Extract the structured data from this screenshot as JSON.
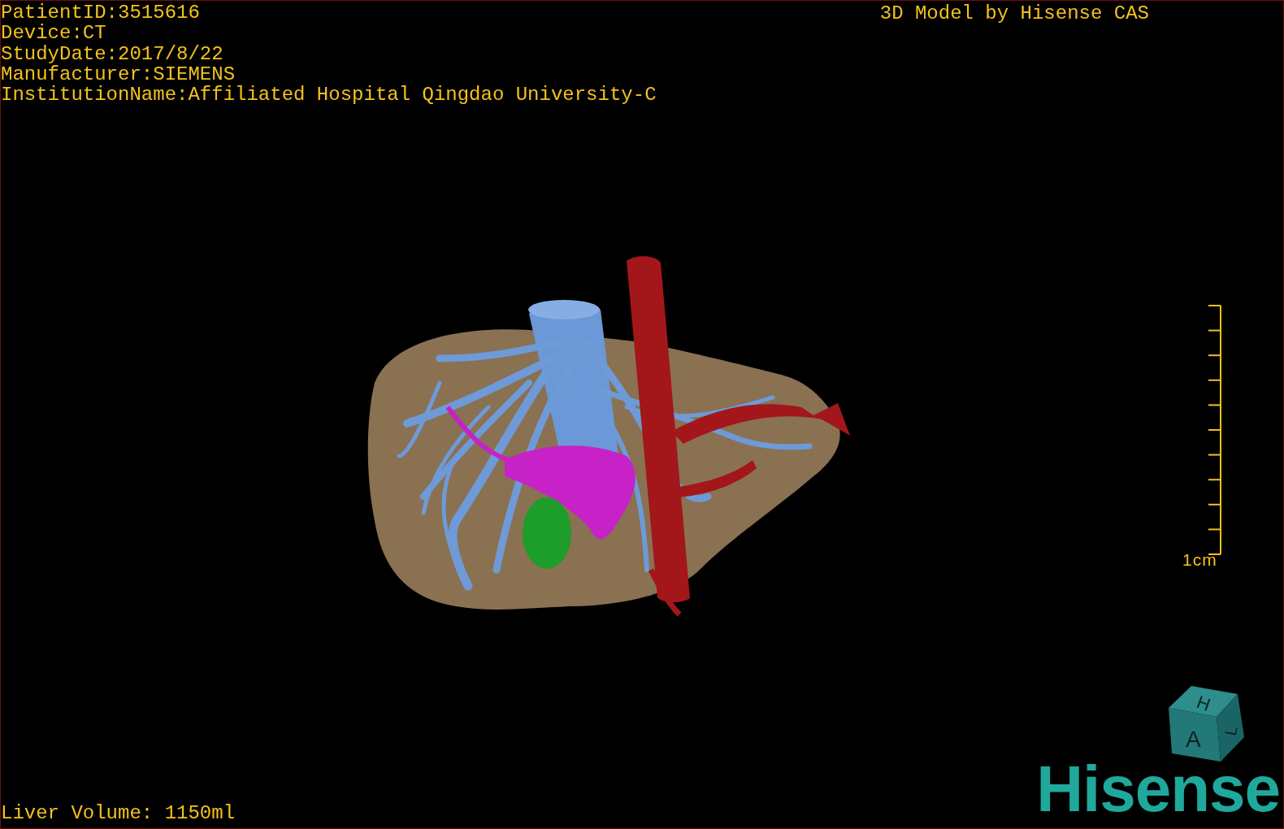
{
  "info_lines": [
    "PatientID:3515616",
    "Device:CT",
    "StudyDate:2017/8/22",
    "Manufacturer:SIEMENS",
    "InstitutionName:Affiliated Hospital Qingdao University-C"
  ],
  "title": "3D Model by Hisense CAS",
  "scale_bar": {
    "label": "1cm"
  },
  "orientation_cube": {
    "top": "H",
    "front": "A",
    "side": "L"
  },
  "logo": "Hisense",
  "footer": "Liver Volume: 1150ml"
}
